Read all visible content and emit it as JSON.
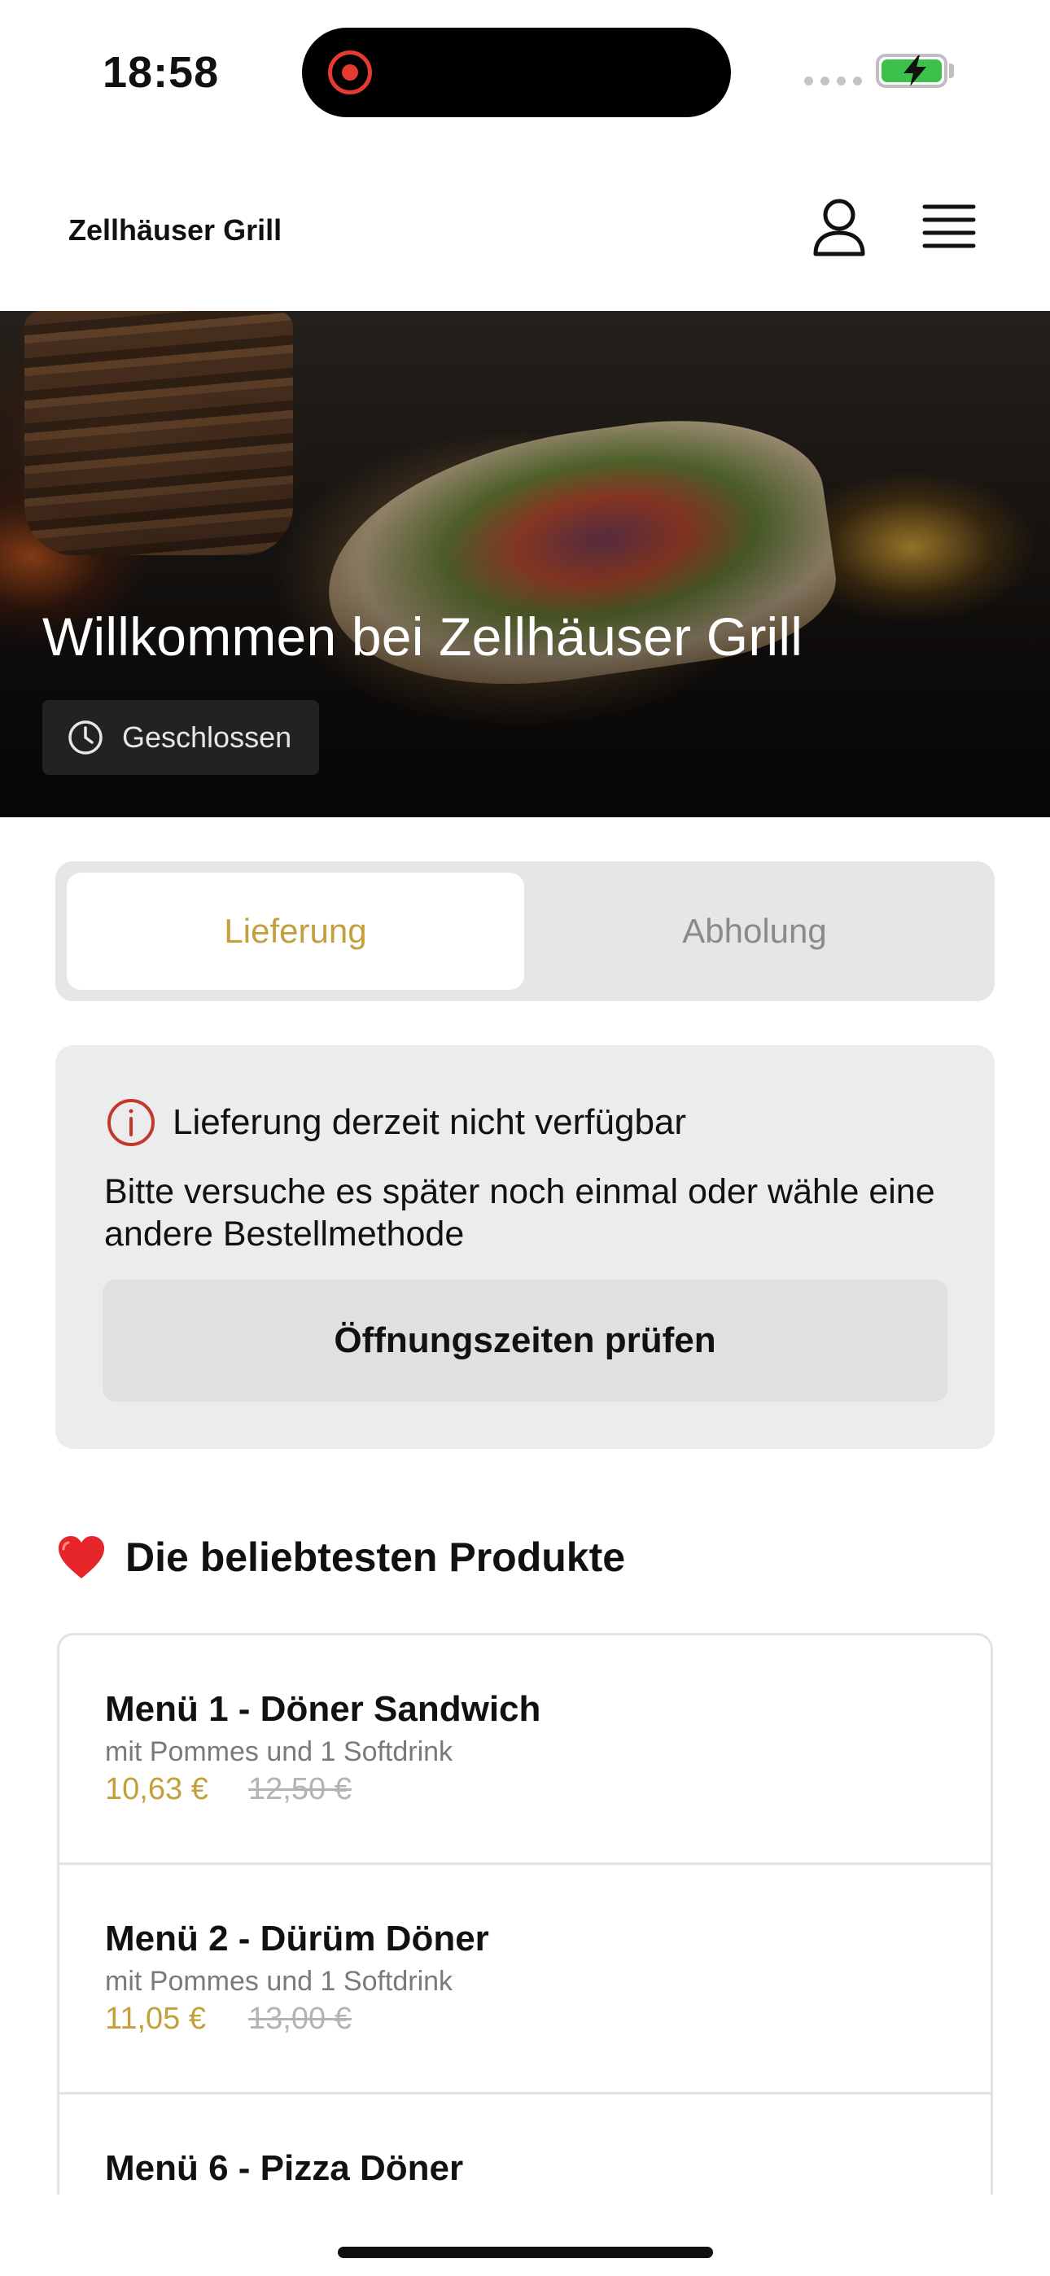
{
  "status_bar": {
    "time": "18:58"
  },
  "header": {
    "brand": "Zellhäuser Grill"
  },
  "hero": {
    "title": "Willkommen bei Zellhäuser Grill",
    "status": "Geschlossen"
  },
  "order_modes": [
    {
      "label": "Lieferung",
      "active": true
    },
    {
      "label": "Abholung",
      "active": false
    }
  ],
  "notice": {
    "title": "Lieferung derzeit nicht verfügbar",
    "body": "Bitte versuche es später noch einmal oder wähle eine andere Bestellmethode",
    "button": "Öffnungszeiten prüfen"
  },
  "popular": {
    "title": "Die beliebtesten Produkte",
    "products": [
      {
        "name": "Menü 1 - Döner Sandwich",
        "description": "mit Pommes und 1 Softdrink",
        "price": "10,63 €",
        "old_price": "12,50 €"
      },
      {
        "name": "Menü 2 - Dürüm Döner",
        "description": "mit Pommes und 1 Softdrink",
        "price": "11,05 €",
        "old_price": "13,00 €"
      },
      {
        "name": "Menü 6 - Pizza Döner"
      }
    ]
  },
  "colors": {
    "accent": "#c4a03c",
    "notice_icon": "#c0392b",
    "battery": "#3cc24b"
  },
  "icons": [
    "record-icon",
    "battery-charging-icon",
    "user-icon",
    "menu-icon",
    "clock-icon",
    "info-icon",
    "heart-icon"
  ]
}
